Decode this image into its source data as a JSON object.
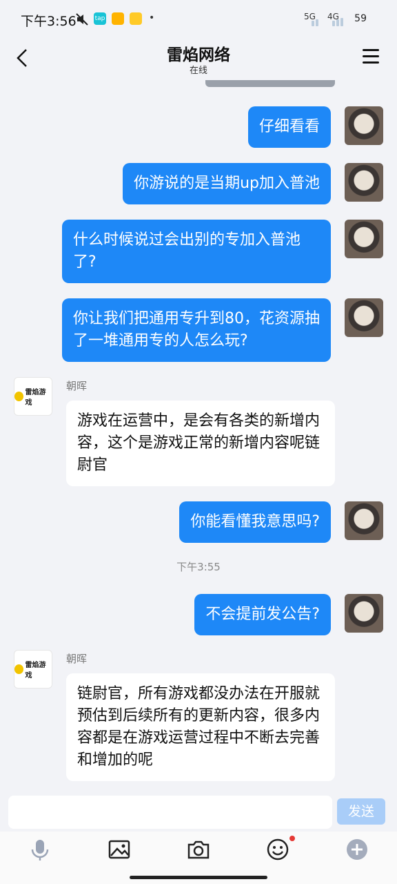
{
  "status_bar": {
    "time": "下午3:56",
    "network_5g": "5G",
    "network_4g": "4G",
    "battery": "59",
    "dot": "•"
  },
  "header": {
    "title": "雷焰网络",
    "status": "在线"
  },
  "messages": [
    {
      "side": "out",
      "text": "仔细看看"
    },
    {
      "side": "out",
      "text": "你游说的是当期up加入普池"
    },
    {
      "side": "out",
      "text": "什么时候说过会出别的专加入普池了?"
    },
    {
      "side": "out",
      "text": "你让我们把通用专升到80，花资源抽了一堆通用专的人怎么玩?"
    },
    {
      "side": "in",
      "sender": "朝晖",
      "text": "游戏在运营中，是会有各类的新增内容，这个是游戏正常的新增内容呢链尉官"
    },
    {
      "side": "out",
      "text": "你能看懂我意思吗?"
    },
    {
      "side": "out",
      "text": "不会提前发公告?"
    },
    {
      "side": "in",
      "sender": "朝晖",
      "text": "链尉官，所有游戏都没办法在开服就预估到后续所有的更新内容，很多内容都是在游戏运营过程中不断去完善和增加的呢"
    }
  ],
  "timestamp": "下午3:55",
  "brand_logo_text": "雷焰游戏",
  "input": {
    "send_label": "发送"
  },
  "toolbar": {
    "icons": [
      "microphone-icon",
      "image-icon",
      "camera-icon",
      "emoji-icon",
      "plus-icon"
    ]
  },
  "colors": {
    "accent": "#1e88f7",
    "send_disabled": "#a9cdf8",
    "background": "#f2f3f7"
  }
}
